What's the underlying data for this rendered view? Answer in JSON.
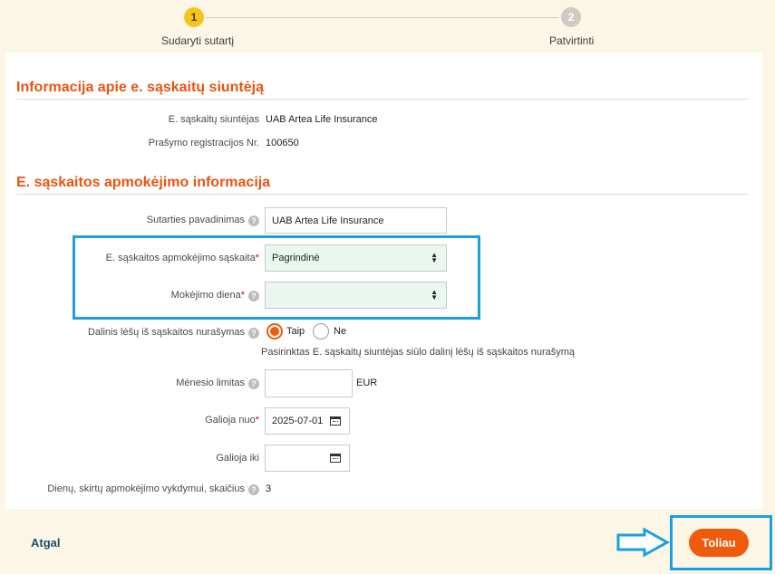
{
  "stepper": {
    "steps": [
      {
        "number": "1",
        "label": "Sudaryti sutartį"
      },
      {
        "number": "2",
        "label": "Patvirtinti"
      }
    ]
  },
  "section1": {
    "title": "Informacija apie e. sąskaitų siuntėją",
    "issuer_label": "E. sąskaitų siuntėjas",
    "issuer_value": "UAB Artea Life Insurance",
    "reg_label": "Prašymo registracijos Nr.",
    "reg_value": "100650"
  },
  "section2": {
    "title": "E. sąskaitos apmokėjimo informacija",
    "contract_name_label": "Sutarties pavadinimas",
    "contract_name_value": "UAB Artea Life Insurance",
    "account_label": "E. sąskaitos apmokėjimo sąskaita",
    "account_value": "Pagrindinė",
    "payday_label": "Mokėjimo diena",
    "payday_value": "",
    "partial_label": "Dalinis lėšų iš sąskaitos nurašymas",
    "partial_yes": "Taip",
    "partial_no": "Ne",
    "partial_selected": "Taip",
    "partial_note": "Pasirinktas E. sąskaitų siuntėjas siūlo dalinį lėšų iš sąskaitos nurašymą",
    "limit_label": "Mėnesio limitas",
    "limit_value": "",
    "currency": "EUR",
    "valid_from_label": "Galioja nuo",
    "valid_from_value": "2025-07-01",
    "valid_to_label": "Galioja iki",
    "valid_to_value": "",
    "days_label": "Dienų, skirtų apmokėjimo vykdymui, skaičius",
    "days_value": "3"
  },
  "footer": {
    "back_label": "Atgal",
    "next_label": "Toliau"
  },
  "icons": {
    "help": "?",
    "required": "*",
    "select_arrows": "▲▼"
  },
  "colors": {
    "accent": "#f05a0c",
    "title": "#e85412",
    "highlight": "#1a9fe0",
    "step_active": "#f6c51b"
  }
}
